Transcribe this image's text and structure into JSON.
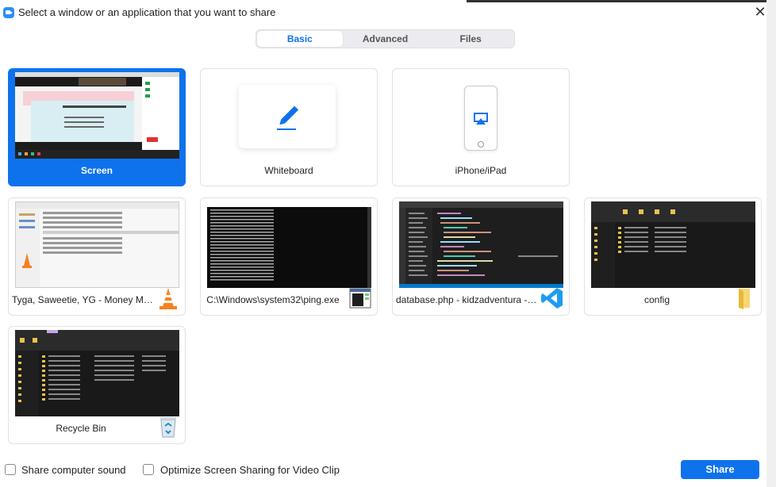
{
  "window": {
    "title": "Select a window or an application that you want to share",
    "close_glyph": "✕"
  },
  "tabs": [
    {
      "label": "Basic",
      "active": true
    },
    {
      "label": "Advanced",
      "active": false
    },
    {
      "label": "Files",
      "active": false
    }
  ],
  "tiles": [
    {
      "label": "Screen",
      "selected": true
    },
    {
      "label": "Whiteboard",
      "icon": "pencil-icon"
    },
    {
      "label": "iPhone/iPad",
      "icon": "airplay-icon"
    },
    {
      "label": "Tyga, Saweetie, YG - Money Mou...",
      "icon": "vlc-icon"
    },
    {
      "label": "C:\\Windows\\system32\\ping.exe",
      "icon": "console-icon"
    },
    {
      "label": "database.php - kidzadventura - V...",
      "icon": "vscode-icon"
    },
    {
      "label": "config",
      "icon": "folder-icon"
    },
    {
      "label": "Recycle Bin",
      "icon": "recycle-bin-icon"
    }
  ],
  "bottom": {
    "share_sound_label": "Share computer sound",
    "optimize_label": "Optimize Screen Sharing for Video Clip",
    "share_button": "Share"
  },
  "colors": {
    "accent": "#0e72ed",
    "brand": "#2d8cff"
  }
}
